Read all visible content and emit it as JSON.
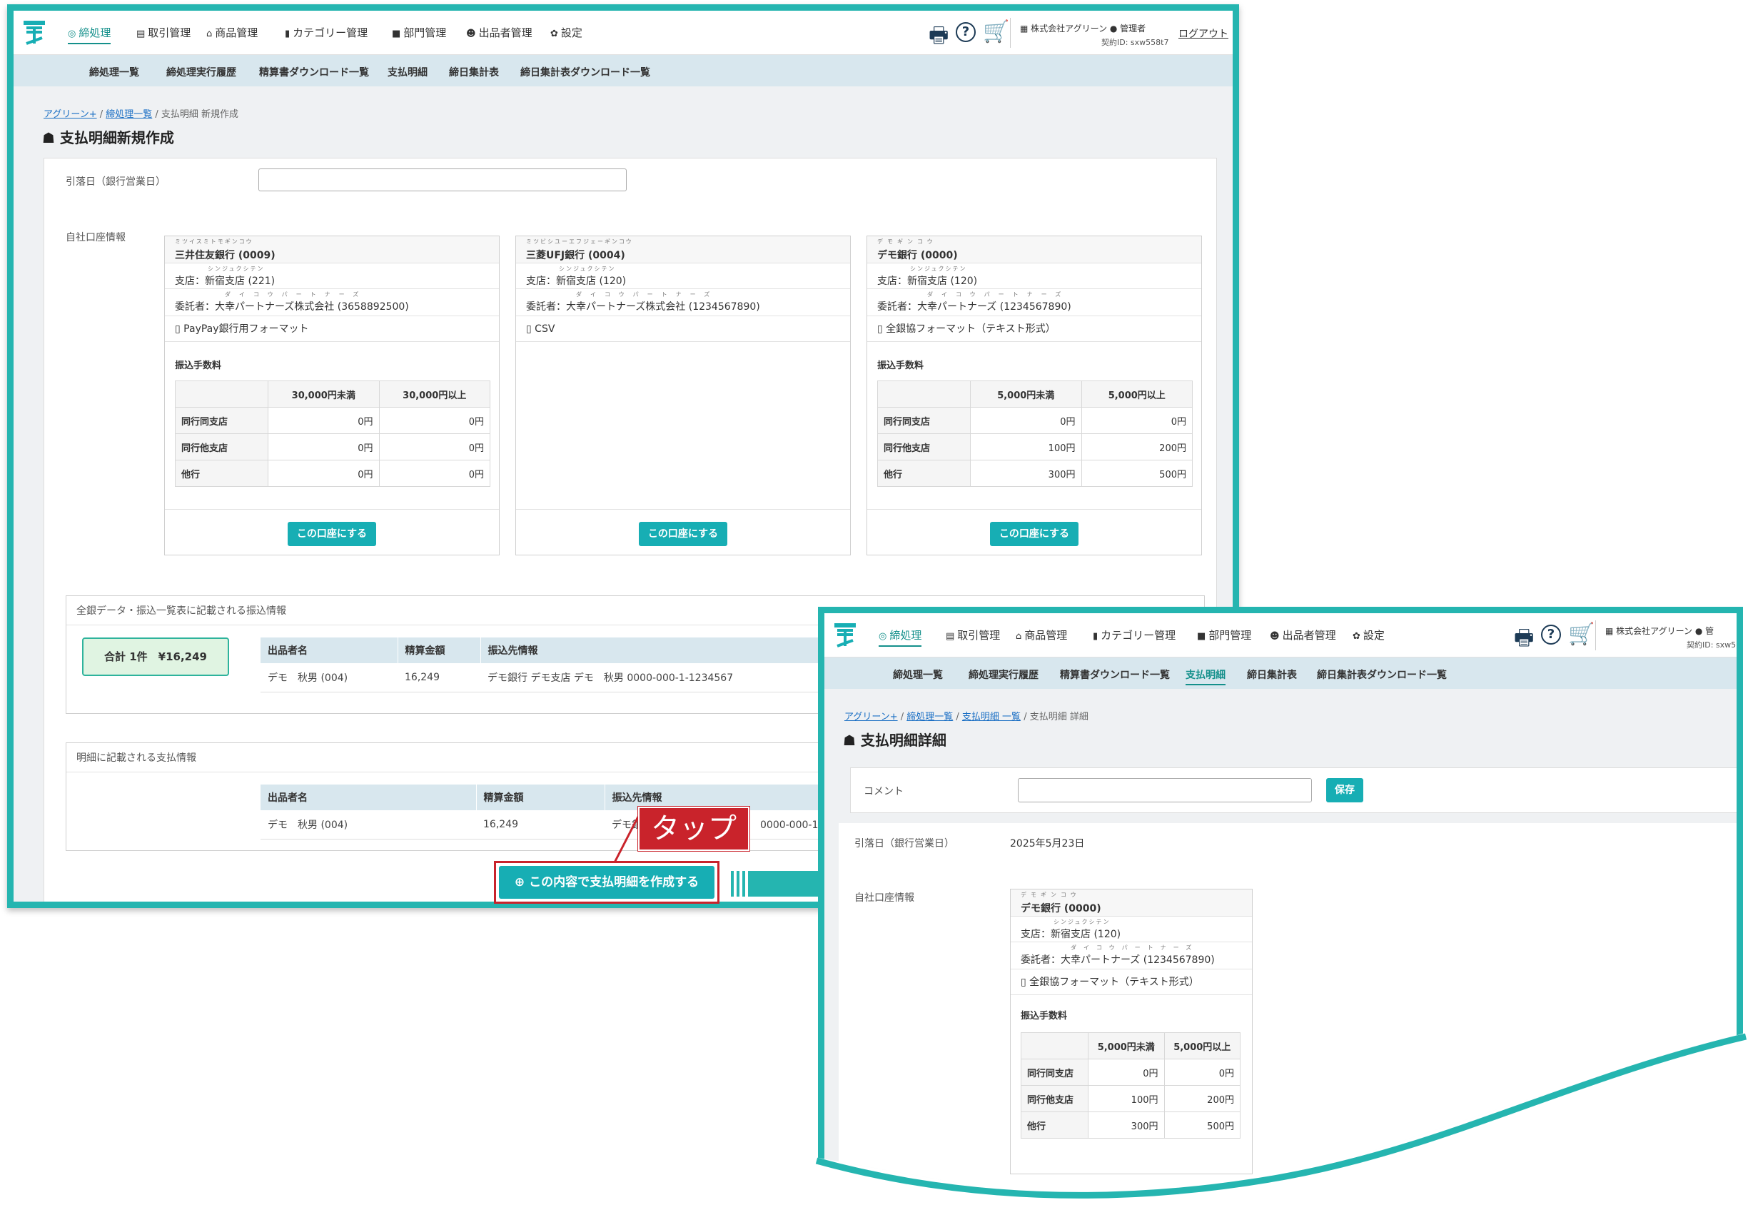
{
  "nav": {
    "items": [
      "締処理",
      "取引管理",
      "商品管理",
      "カテゴリー管理",
      "部門管理",
      "出品者管理",
      "設定"
    ],
    "company": "株式会社アグリーン",
    "role": "管理者",
    "contract": "契約ID: sxw558t7",
    "logout": "ログアウト",
    "help": "?"
  },
  "subnav": {
    "items": [
      "締処理一覧",
      "締処理実行履歴",
      "精算書ダウンロード一覧",
      "支払明細",
      "締日集計表",
      "締日集計表ダウンロード一覧"
    ]
  },
  "create": {
    "breadcrumb": [
      "アグリーン+",
      "締処理一覧",
      "支払明細 新規作成"
    ],
    "title": "支払明細新規作成",
    "withdraw_label": "引落日（銀行営業日）",
    "account_label": "自社口座情報",
    "accounts": [
      {
        "ruby": "ミツイスミトモギンコウ",
        "bank": "三井住友銀行 (0009)",
        "branch_ruby": "シンジュクシテン",
        "branch": "支店：新宿支店 (221)",
        "owner_ruby": "ダイコウパートナーズ",
        "owner": "委託者：大幸パートナーズ株式会社 (3658892500)",
        "format": "PayPay銀行用フォーマット",
        "fee_title": "振込手数料",
        "fee_cols": [
          "30,000円未満",
          "30,000円以上"
        ],
        "fee_rows": [
          {
            "label": "同行同支店",
            "a": "0円",
            "b": "0円"
          },
          {
            "label": "同行他支店",
            "a": "0円",
            "b": "0円"
          },
          {
            "label": "他行",
            "a": "0円",
            "b": "0円"
          }
        ],
        "button": "この口座にする"
      },
      {
        "ruby": "ミツビシユーエフジェーギンコウ",
        "bank": "三菱UFJ銀行 (0004)",
        "branch_ruby": "シンジュクシテン",
        "branch": "支店：新宿支店 (120)",
        "owner_ruby": "ダイコウパートナーズ",
        "owner": "委託者：大幸パートナーズ株式会社 (1234567890)",
        "format": "CSV",
        "button": "この口座にする"
      },
      {
        "ruby": "デモギンコウ",
        "bank": "デモ銀行 (0000)",
        "branch_ruby": "シンジュクシテン",
        "branch": "支店：新宿支店 (120)",
        "owner_ruby": "ダイコウパートナーズ",
        "owner": "委託者：大幸パートナーズ (1234567890)",
        "format": "全銀協フォーマット（テキスト形式）",
        "fee_title": "振込手数料",
        "fee_cols": [
          "5,000円未満",
          "5,000円以上"
        ],
        "fee_rows": [
          {
            "label": "同行同支店",
            "a": "0円",
            "b": "0円"
          },
          {
            "label": "同行他支店",
            "a": "100円",
            "b": "200円"
          },
          {
            "label": "他行",
            "a": "300円",
            "b": "500円"
          }
        ],
        "button": "この口座にする"
      }
    ],
    "zengin": {
      "title": "全銀データ・振込一覧表に記載される振込情報",
      "total": "合計 1件　¥16,249",
      "headers": [
        "出品者名",
        "精算金額",
        "振込先情報"
      ],
      "row": {
        "name": "デモ　秋男 (004)",
        "amount": "16,249",
        "dest": "デモ銀行 デモ支店 デモ　秋男 0000-000-1-1234567"
      }
    },
    "statement": {
      "title": "明細に記載される支払情報",
      "headers": [
        "出品者名",
        "精算金額",
        "振込先情報"
      ],
      "row": {
        "name": "デモ　秋男 (004)",
        "amount": "16,249",
        "dest_a": "デモ銀行",
        "dest_b": "0000-000-1-12345"
      }
    },
    "submit": "この内容で支払明細を作成する",
    "tap": "タップ"
  },
  "detail": {
    "company": "株式会社アグリーン",
    "role": "管",
    "contract": "契約ID: sxw5",
    "breadcrumb": [
      "アグリーン+",
      "締処理一覧",
      "支払明細 一覧",
      "支払明細 詳細"
    ],
    "title": "支払明細詳細",
    "comment_label": "コメント",
    "save": "保存",
    "withdraw_label": "引落日（銀行営業日）",
    "withdraw_value": "2025年5月23日",
    "account_label": "自社口座情報",
    "account": {
      "ruby": "デモギンコウ",
      "bank": "デモ銀行 (0000)",
      "branch_ruby": "シンジュクシテン",
      "branch": "支店：新宿支店 (120)",
      "owner_ruby": "ダイコウパートナーズ",
      "owner": "委託者：大幸パートナーズ (1234567890)",
      "format": "全銀協フォーマット（テキスト形式）",
      "fee_title": "振込手数料",
      "fee_cols": [
        "5,000円未満",
        "5,000円以上"
      ],
      "fee_rows": [
        {
          "label": "同行同支店",
          "a": "0円",
          "b": "0円"
        },
        {
          "label": "同行他支店",
          "a": "100円",
          "b": "200円"
        },
        {
          "label": "他行",
          "a": "300円",
          "b": "500円"
        }
      ]
    }
  },
  "colors": {
    "accent": "#17aeb4",
    "frame": "#25b5b0",
    "highlight": "#c9232b"
  },
  "icons": [
    "logo-icon",
    "check-circle-icon",
    "receipt-icon",
    "shop-icon",
    "bookmark-icon",
    "folder-icon",
    "users-icon",
    "gear-icon",
    "printer-icon",
    "help-icon",
    "cart-icon",
    "building-icon",
    "person-icon",
    "piggy-bank-icon",
    "document-icon",
    "plus-circle-icon",
    "arrow-right-icon"
  ]
}
